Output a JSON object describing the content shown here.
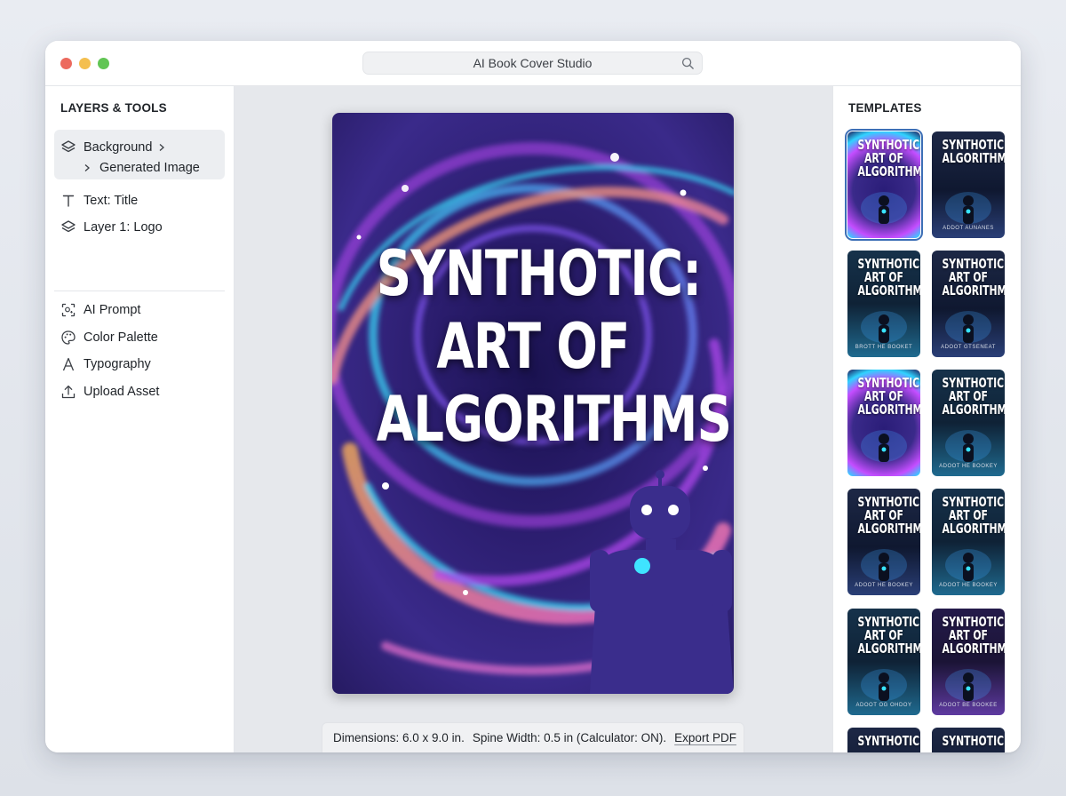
{
  "window": {
    "title": "AI Book Cover Studio"
  },
  "left_panel": {
    "title": "LAYERS & TOOLS",
    "layers": [
      {
        "label": "Background",
        "icon": "layers-icon",
        "expanded": true
      },
      {
        "label": "Generated Image",
        "icon": "chevron-right-icon"
      },
      {
        "label": "Text: Title",
        "icon": "text-icon"
      },
      {
        "label": "Layer 1: Logo",
        "icon": "layers-icon"
      }
    ],
    "tools": [
      {
        "label": "AI Prompt",
        "icon": "ai-scan-icon"
      },
      {
        "label": "Color Palette",
        "icon": "palette-icon"
      },
      {
        "label": "Typography",
        "icon": "typography-icon"
      },
      {
        "label": "Upload Asset",
        "icon": "upload-icon"
      }
    ]
  },
  "cover": {
    "title_lines": [
      "SYNTHOTIC:",
      "ART OF",
      "ALGORITHMS"
    ]
  },
  "status": {
    "dimensions": "Dimensions: 6.0 x 9.0 in.",
    "spine": "Spine Width: 0.5 in (Calculator: ON).",
    "export": "Export PDF"
  },
  "templates": {
    "title": "TEMPLATES",
    "items": [
      {
        "title": "SYNTHOTIC: ART OF ALGORITHMS",
        "author": "",
        "style": "swirl",
        "selected": true
      },
      {
        "title": "SYNTHOTIC: ALGORITHMS",
        "author": "ADDOT AUNANES",
        "style": "dark"
      },
      {
        "title": "SYNTHOTIC: ART OF ALGORITHMS",
        "author": "BROTT HE BOOKET",
        "style": "teal"
      },
      {
        "title": "SYNTHOTIC: ART OF ALGORITHMS",
        "author": "ADOOT GTSENEAT",
        "style": "dark"
      },
      {
        "title": "SYNTHOTIC: ART OF ALGORITHMS",
        "author": "",
        "style": "swirl"
      },
      {
        "title": "SYNTHOTIC: ART OF ALGORITHMS",
        "author": "ADOOT HE BOOKEY",
        "style": "teal"
      },
      {
        "title": "SYNTHOTIC: ART OF ALGORITHMS",
        "author": "ADOOT HE BOOKEY",
        "style": "dark"
      },
      {
        "title": "SYNTHOTIC: ART OF ALGORITHMS",
        "author": "ADOOT HE BOOKEY",
        "style": "teal"
      },
      {
        "title": "SYNTHOTIC: ART OF ALGORITHMS",
        "author": "ADOOT OG OHDOY",
        "style": "teal"
      },
      {
        "title": "SYNTHOTIC: ART OF ALGORITHMS",
        "author": "ADOOT BE BOOKEE",
        "style": "purple"
      },
      {
        "title": "SYNTHOTIC:",
        "author": "",
        "style": "dark"
      },
      {
        "title": "SYNTHOTIC:",
        "author": "",
        "style": "dark"
      }
    ]
  },
  "colors": {
    "accent": "#3d6fb6",
    "cover_bg": "#231a5c",
    "orange": "#ff9a4a",
    "cyan": "#2fd3ff",
    "magenta": "#c44dff"
  }
}
